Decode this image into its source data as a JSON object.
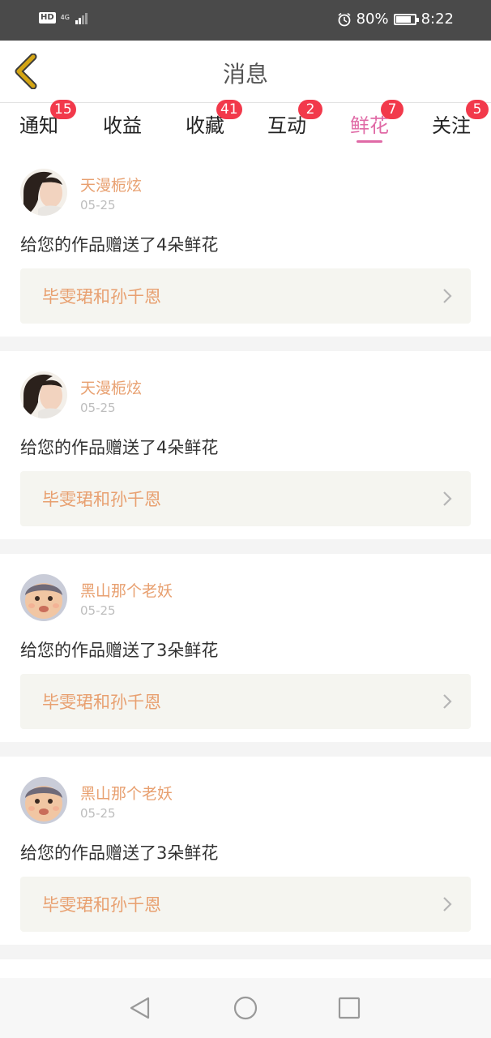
{
  "status_bar": {
    "hd_label": "HD",
    "network": "4G",
    "battery_percent": "80%",
    "battery_level": 0.8,
    "time": "8:22",
    "icons": [
      "alarm-icon",
      "signal-icon",
      "battery-icon"
    ]
  },
  "header": {
    "title": "消息",
    "back_icon": "chevron-left-icon",
    "back_color": "#d4a514"
  },
  "tabs": [
    {
      "label": "通知",
      "badge": "15"
    },
    {
      "label": "收益",
      "badge": ""
    },
    {
      "label": "收藏",
      "badge": "41"
    },
    {
      "label": "互动",
      "badge": "2"
    },
    {
      "label": "鲜花",
      "badge": "7",
      "active": true
    },
    {
      "label": "关注",
      "badge": "5"
    }
  ],
  "colors": {
    "accent": "#e06aa6",
    "badge": "#f2394b",
    "username": "#e8a070"
  },
  "messages": [
    {
      "user": "天漫栀炫",
      "date": "05-25",
      "text": "给您的作品赠送了4朵鲜花",
      "work": "毕雯珺和孙千恩"
    },
    {
      "user": "天漫栀炫",
      "date": "05-25",
      "text": "给您的作品赠送了4朵鲜花",
      "work": "毕雯珺和孙千恩"
    },
    {
      "user": "黑山那个老妖",
      "date": "05-25",
      "text": "给您的作品赠送了3朵鲜花",
      "work": "毕雯珺和孙千恩"
    },
    {
      "user": "黑山那个老妖",
      "date": "05-25",
      "text": "给您的作品赠送了3朵鲜花",
      "work": "毕雯珺和孙千恩"
    }
  ],
  "nav_bar": {
    "icons": [
      "back-triangle-icon",
      "home-circle-icon",
      "recents-square-icon"
    ]
  }
}
